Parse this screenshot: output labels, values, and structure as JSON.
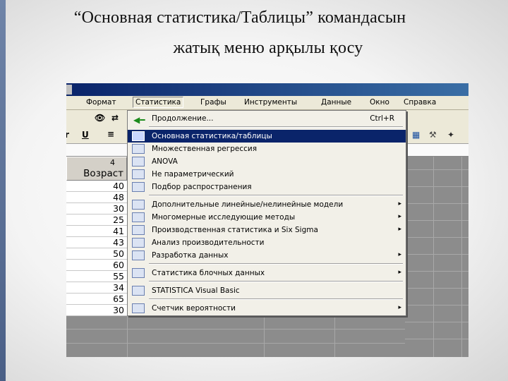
{
  "caption": {
    "line1": "“Основная статистика/Таблицы” командасын",
    "line2": "жатық меню арқылы қосу"
  },
  "menubar": {
    "items": [
      "Формат",
      "Статистика",
      "Графы",
      "Инструменты",
      "Данные",
      "Окно",
      "Справка"
    ],
    "active": "Статистика"
  },
  "toolbar": {
    "icons": [
      "binoculars-icon",
      "replace-icon",
      "underline-icon",
      "align-icon",
      "chart-icon",
      "tools-icon",
      "network-icon"
    ],
    "underline_label": "U",
    "leftmost_label": "r"
  },
  "column": {
    "number": "4",
    "name": "Возраст",
    "values": [
      "40",
      "48",
      "30",
      "25",
      "41",
      "43",
      "50",
      "60",
      "55",
      "34",
      "65",
      "30"
    ]
  },
  "stat_menu": {
    "items": [
      {
        "label": "Продолжение...",
        "shortcut": "Ctrl+R",
        "icon": "green-arrow-icon",
        "submenu": false
      },
      {
        "label": "Основная статистика/таблицы",
        "icon": "basic-stats-icon",
        "submenu": false,
        "highlighted": true
      },
      {
        "label": "Множественная регрессия",
        "icon": "regression-icon",
        "submenu": false
      },
      {
        "label": "ANOVA",
        "icon": "anova-icon",
        "submenu": false
      },
      {
        "label": "Не параметрический",
        "icon": "nonparametric-icon",
        "submenu": false
      },
      {
        "label": "Подбор распространения",
        "icon": "distribution-fit-icon",
        "submenu": false
      },
      {
        "label": "Дополнительные линейные/нелинейные модели",
        "icon": "linear-models-icon",
        "submenu": true
      },
      {
        "label": "Многомерные исследующие методы",
        "icon": "multivariate-icon",
        "submenu": true
      },
      {
        "label": "Производственная статистика и Six Sigma",
        "icon": "six-sigma-icon",
        "submenu": true
      },
      {
        "label": "Анализ производительности",
        "icon": "power-analysis-icon",
        "submenu": false
      },
      {
        "label": "Разработка данных",
        "icon": "data-mining-icon",
        "submenu": true
      },
      {
        "label": "Статистика блочных данных",
        "icon": "block-data-icon",
        "submenu": true
      },
      {
        "label": "STATISTICA Visual Basic",
        "icon": "visual-basic-icon",
        "submenu": false
      },
      {
        "label": "Счетчик вероятности",
        "icon": "probability-calculator-icon",
        "submenu": true
      }
    ]
  }
}
